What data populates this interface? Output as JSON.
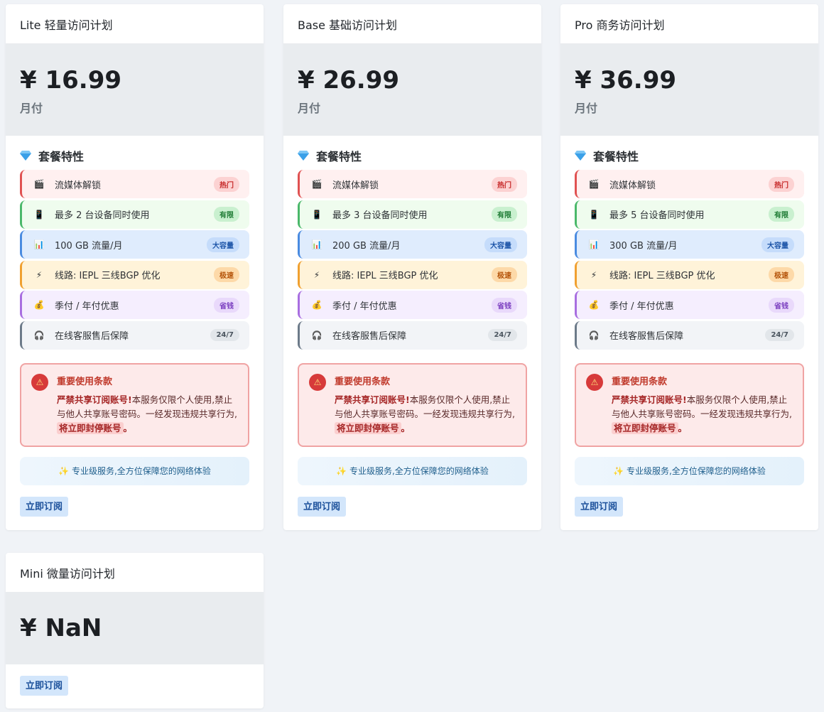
{
  "plans": [
    {
      "name": "Lite 轻量访问计划",
      "price": "¥ 16.99",
      "period": "月付",
      "features_title": "套餐特性",
      "features": [
        {
          "icon": "clapper-icon",
          "glyph": "🎬",
          "text": "流媒体解锁",
          "tag": "热门",
          "color": "red"
        },
        {
          "icon": "device-icon",
          "glyph": "📱",
          "text": "最多 2 台设备同时使用",
          "tag": "有限",
          "color": "green"
        },
        {
          "icon": "chart-icon",
          "glyph": "📊",
          "text": "100 GB 流量/月",
          "tag": "大容量",
          "color": "blue"
        },
        {
          "icon": "lightning-icon",
          "glyph": "⚡",
          "text": "线路: IEPL 三线BGP 优化",
          "tag": "极速",
          "color": "orange"
        },
        {
          "icon": "money-bag-icon",
          "glyph": "💰",
          "text": "季付 / 年付优惠",
          "tag": "省钱",
          "color": "purple"
        },
        {
          "icon": "headphones-icon",
          "glyph": "🎧",
          "text": "在线客服售后保障",
          "tag": "24/7",
          "color": "gray"
        }
      ],
      "warning": {
        "title": "重要使用条款",
        "bold": "严禁共享订阅账号!",
        "text": "本服务仅限个人使用,禁止与他人共享账号密码。一经发现违规共享行为,",
        "highlight": "将立即封停账号",
        "end": "。"
      },
      "service": "✨ 专业级服务,全方位保障您的网络体验",
      "button": "立即订阅"
    },
    {
      "name": "Base 基础访问计划",
      "price": "¥ 26.99",
      "period": "月付",
      "features_title": "套餐特性",
      "features": [
        {
          "icon": "clapper-icon",
          "glyph": "🎬",
          "text": "流媒体解锁",
          "tag": "热门",
          "color": "red"
        },
        {
          "icon": "device-icon",
          "glyph": "📱",
          "text": "最多 3 台设备同时使用",
          "tag": "有限",
          "color": "green"
        },
        {
          "icon": "chart-icon",
          "glyph": "📊",
          "text": "200 GB 流量/月",
          "tag": "大容量",
          "color": "blue"
        },
        {
          "icon": "lightning-icon",
          "glyph": "⚡",
          "text": "线路: IEPL 三线BGP 优化",
          "tag": "极速",
          "color": "orange"
        },
        {
          "icon": "money-bag-icon",
          "glyph": "💰",
          "text": "季付 / 年付优惠",
          "tag": "省钱",
          "color": "purple"
        },
        {
          "icon": "headphones-icon",
          "glyph": "🎧",
          "text": "在线客服售后保障",
          "tag": "24/7",
          "color": "gray"
        }
      ],
      "warning": {
        "title": "重要使用条款",
        "bold": "严禁共享订阅账号!",
        "text": "本服务仅限个人使用,禁止与他人共享账号密码。一经发现违规共享行为,",
        "highlight": "将立即封停账号",
        "end": "。"
      },
      "service": "✨ 专业级服务,全方位保障您的网络体验",
      "button": "立即订阅"
    },
    {
      "name": "Pro 商务访问计划",
      "price": "¥ 36.99",
      "period": "月付",
      "features_title": "套餐特性",
      "features": [
        {
          "icon": "clapper-icon",
          "glyph": "🎬",
          "text": "流媒体解锁",
          "tag": "热门",
          "color": "red"
        },
        {
          "icon": "device-icon",
          "glyph": "📱",
          "text": "最多 5 台设备同时使用",
          "tag": "有限",
          "color": "green"
        },
        {
          "icon": "chart-icon",
          "glyph": "📊",
          "text": "300 GB 流量/月",
          "tag": "大容量",
          "color": "blue"
        },
        {
          "icon": "lightning-icon",
          "glyph": "⚡",
          "text": "线路: IEPL 三线BGP 优化",
          "tag": "极速",
          "color": "orange"
        },
        {
          "icon": "money-bag-icon",
          "glyph": "💰",
          "text": "季付 / 年付优惠",
          "tag": "省钱",
          "color": "purple"
        },
        {
          "icon": "headphones-icon",
          "glyph": "🎧",
          "text": "在线客服售后保障",
          "tag": "24/7",
          "color": "gray"
        }
      ],
      "warning": {
        "title": "重要使用条款",
        "bold": "严禁共享订阅账号!",
        "text": "本服务仅限个人使用,禁止与他人共享账号密码。一经发现违规共享行为,",
        "highlight": "将立即封停账号",
        "end": "。"
      },
      "service": "✨ 专业级服务,全方位保障您的网络体验",
      "button": "立即订阅"
    }
  ],
  "mini": {
    "name": "Mini 微量访问计划",
    "price": "¥ NaN",
    "button": "立即订阅"
  }
}
